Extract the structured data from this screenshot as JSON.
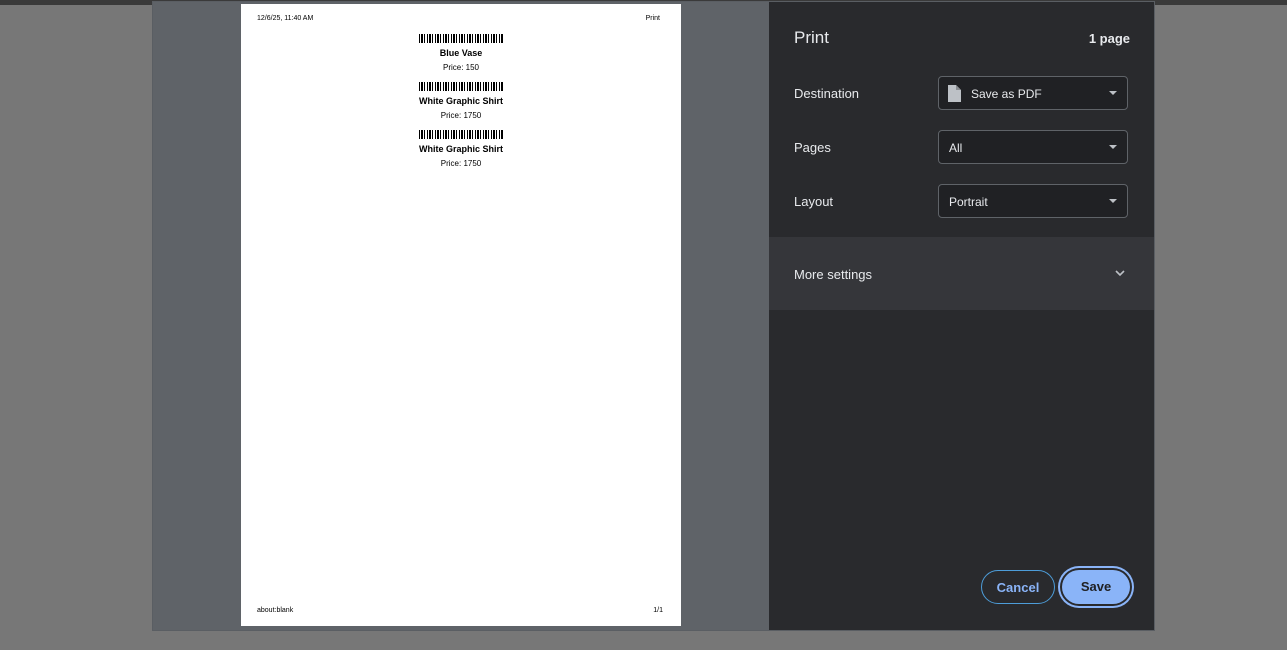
{
  "preview": {
    "header_date": "12/6/25, 11:40 AM",
    "header_title": "Print",
    "footer_url": "about:blank",
    "footer_page": "1/1",
    "labels": [
      {
        "name": "Blue Vase",
        "price": "Price: 150"
      },
      {
        "name": "White Graphic Shirt",
        "price": "Price: 1750"
      },
      {
        "name": "White Graphic Shirt",
        "price": "Price: 1750"
      }
    ]
  },
  "panel": {
    "title": "Print",
    "page_count": "1 page",
    "destination": {
      "label": "Destination",
      "value": "Save as PDF",
      "icon": "file-icon"
    },
    "pages": {
      "label": "Pages",
      "value": "All"
    },
    "layout": {
      "label": "Layout",
      "value": "Portrait"
    },
    "more_settings": "More settings",
    "cancel": "Cancel",
    "save": "Save"
  },
  "colors": {
    "panel_bg": "#292a2d",
    "accent": "#8ab4f8",
    "preview_bg": "#5f6368"
  }
}
